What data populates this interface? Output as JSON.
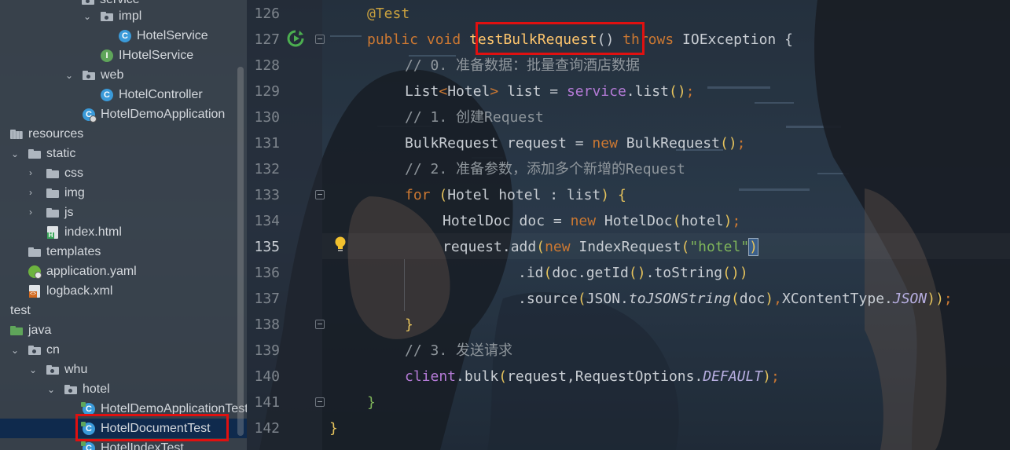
{
  "project_tree": {
    "items": [
      {
        "label": "impl"
      },
      {
        "label": "HotelService"
      },
      {
        "label": "IHotelService"
      },
      {
        "label": "web"
      },
      {
        "label": "HotelController"
      },
      {
        "label": "HotelDemoApplication"
      },
      {
        "label": "resources"
      },
      {
        "label": "static"
      },
      {
        "label": "css"
      },
      {
        "label": "img"
      },
      {
        "label": "js"
      },
      {
        "label": "index.html"
      },
      {
        "label": "templates"
      },
      {
        "label": "application.yaml"
      },
      {
        "label": "logback.xml"
      },
      {
        "label": "test"
      },
      {
        "label": "java"
      },
      {
        "label": "cn"
      },
      {
        "label": "whu"
      },
      {
        "label": "hotel"
      },
      {
        "label": "HotelDemoApplicationTests"
      },
      {
        "label": "HotelDocumentTest"
      },
      {
        "label": "HotelIndexTest"
      }
    ],
    "partial_top_label": "service",
    "icon_letters": {
      "class": "C",
      "interface": "I",
      "html": "H"
    }
  },
  "editor": {
    "current_line": 135,
    "line_numbers": [
      126,
      127,
      128,
      129,
      130,
      131,
      132,
      133,
      134,
      135,
      136,
      137,
      138,
      139,
      140,
      141,
      142
    ],
    "lines": {
      "l126": {
        "annotation": "@Test"
      },
      "l127": {
        "kw1": "public",
        "kw2": "void",
        "method": "testBulkRequest",
        "parens": "()",
        "kw3": "throws",
        "type": "IOException",
        "brace": "{"
      },
      "l128": {
        "comment": "// 0. 准备数据：批量查询酒店数据"
      },
      "l129": {
        "type": "List",
        "lt": "<",
        "generic": "Hotel",
        "gt": ">",
        "rest": " list = ",
        "field": "service",
        "call": ".list",
        "parens": "()",
        "semi": ";"
      },
      "l130": {
        "comment": "// 1. 创建Request"
      },
      "l131": {
        "decl": "BulkRequest request = ",
        "kw": "new",
        "ctor": " BulkRequest",
        "parens": "()",
        "semi": ";"
      },
      "l132": {
        "comment": "// 2. 准备参数，添加多个新增的Request"
      },
      "l133": {
        "kw": "for",
        "open": " (",
        "body": "Hotel hotel : list",
        "close": ")",
        "brace": " {"
      },
      "l134": {
        "decl": "HotelDoc doc = ",
        "kw": "new",
        "ctor": " HotelDoc",
        "open": "(",
        "arg": "hotel",
        "close": ")",
        "semi": ";"
      },
      "l135": {
        "call": "request.add",
        "open": "(",
        "kw": "new",
        "ctor": " IndexRequest",
        "open2": "(",
        "str": "\"hotel\"",
        "close2": ")"
      },
      "l136": {
        "call": ".id",
        "open": "(",
        "arg": "doc.getId",
        "p1": "()",
        "call2": ".toString",
        "p2": "()",
        "close": ")"
      },
      "l137": {
        "call": ".source",
        "open": "(",
        "cls": "JSON.",
        "method": "toJSONString",
        "open2": "(",
        "arg": "doc",
        "close2": ")",
        "comma": ",",
        "cls2": "XContentType.",
        "const": "JSON",
        "close": "))",
        "semi": ";"
      },
      "l138": {
        "brace": "}"
      },
      "l139": {
        "comment": "// 3. 发送请求"
      },
      "l140": {
        "field": "client",
        "call": ".bulk",
        "open": "(",
        "arg": "request,RequestOptions.",
        "const": "DEFAULT",
        "close": ")",
        "semi": ";"
      },
      "l141": {
        "brace": "}"
      },
      "l142": {
        "brace": "}"
      }
    }
  },
  "colors": {
    "highlight_box": "#e01010",
    "keyword": "#cc7832",
    "method": "#ffc66d",
    "comment": "#8f969c",
    "field": "#b47ad6",
    "string": "#7fb55a",
    "run_icon": "#4caf50",
    "bulb": "#f2c12e",
    "selected_row": "#0f2a4d"
  }
}
